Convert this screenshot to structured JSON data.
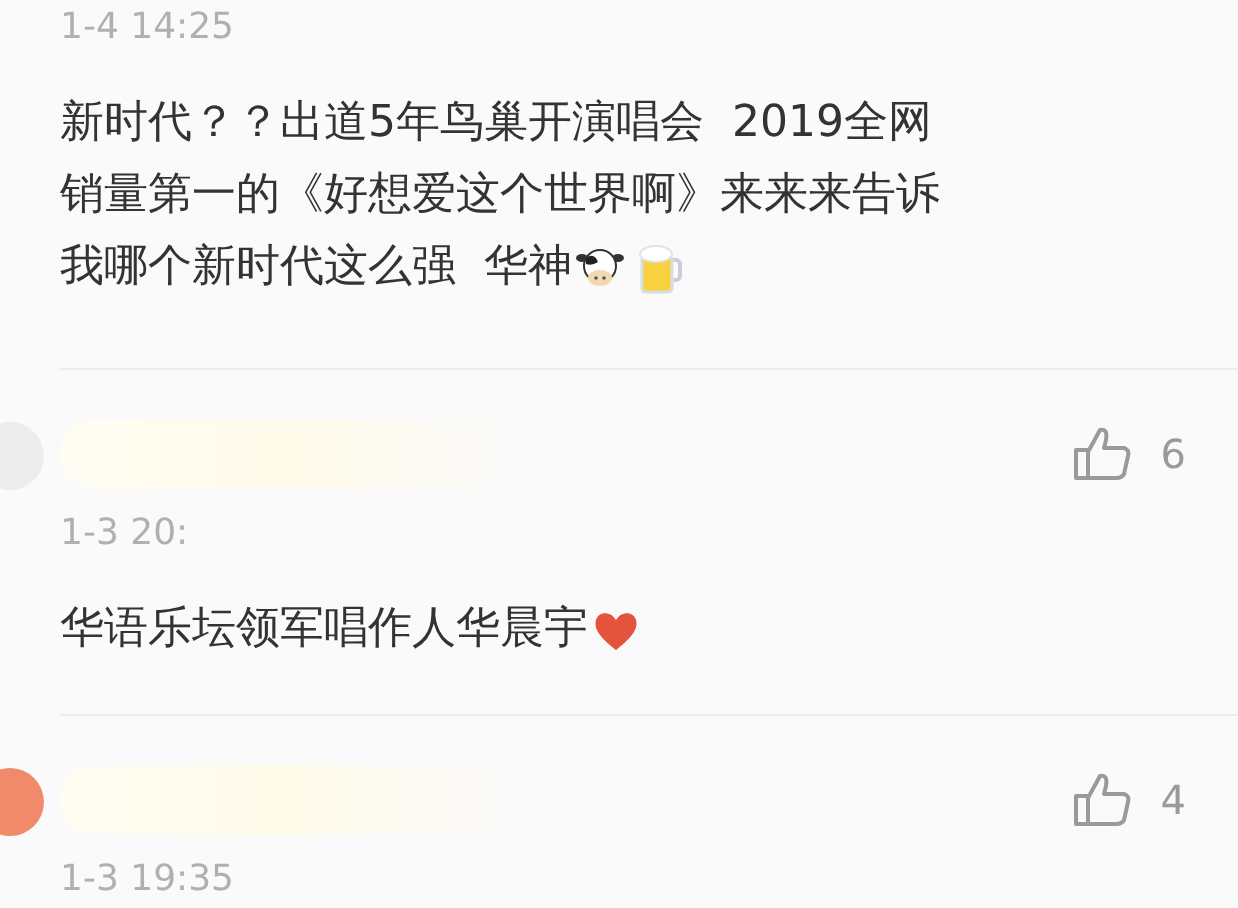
{
  "comments": [
    {
      "time": "1-4 14:25",
      "lines": [
        "新时代？？出道5年鸟巢开演唱会  2019全网",
        "销量第一的《好想爱这个世界啊》来来来告诉",
        "我哪个新时代这么强  华神"
      ],
      "emoji": [
        {
          "kind": "cow"
        },
        {
          "kind": "beer"
        }
      ]
    },
    {
      "likes": "6",
      "time": "1-3 20:",
      "lines": [
        "华语乐坛领军唱作人华晨宇"
      ],
      "emoji": [
        {
          "kind": "heart"
        }
      ]
    },
    {
      "likes": "4",
      "time": "1-3 19:35"
    }
  ]
}
